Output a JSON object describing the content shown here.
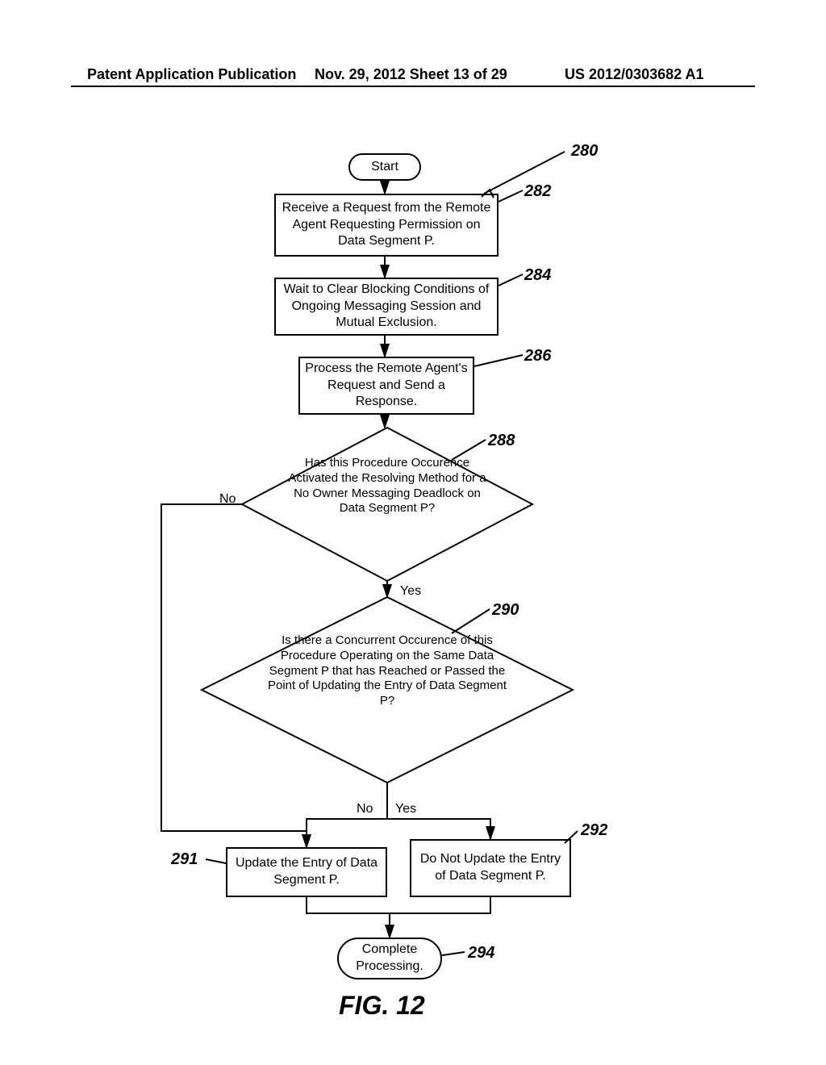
{
  "header": {
    "left": "Patent Application Publication",
    "mid": "Nov. 29, 2012  Sheet 13 of 29",
    "right": "US 2012/0303682 A1"
  },
  "refs": {
    "r280": "280",
    "r282": "282",
    "r284": "284",
    "r286": "286",
    "r288": "288",
    "r290": "290",
    "r291": "291",
    "r292": "292",
    "r294": "294"
  },
  "nodes": {
    "start": "Start",
    "n282": "Receive a Request from the Remote Agent Requesting Permission on Data Segment P.",
    "n284": "Wait to Clear Blocking Conditions of Ongoing Messaging Session and Mutual Exclusion.",
    "n286": "Process the Remote Agent's Request and Send a Response.",
    "n288": "Has this Procedure Occurence Activated the Resolving Method for a No Owner Messaging Deadlock on Data Segment P?",
    "n290": "Is there a Concurrent Occurence of this Procedure Operating on the Same Data Segment P that has Reached or Passed the Point of Updating the Entry of Data Segment P?",
    "n291": "Update the Entry of Data Segment P.",
    "n292": "Do Not Update the Entry of Data Segment P.",
    "end": "Complete Processing."
  },
  "labels": {
    "no": "No",
    "yes": "Yes"
  },
  "figure": "FIG.  12"
}
